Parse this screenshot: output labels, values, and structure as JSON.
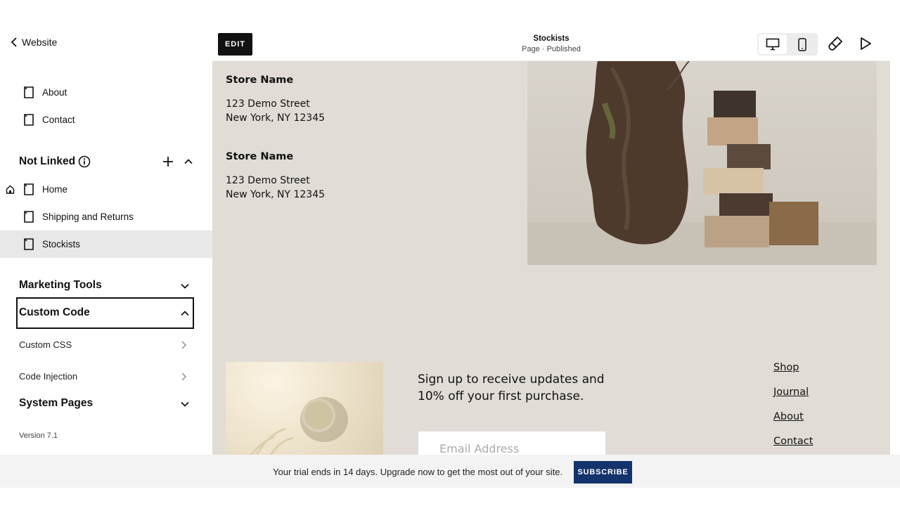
{
  "sidebar": {
    "back_label": "Website",
    "linked_items": [
      {
        "label": "About",
        "icon": "page-icon"
      },
      {
        "label": "Contact",
        "icon": "page-icon"
      }
    ],
    "not_linked": {
      "title": "Not Linked",
      "items": [
        {
          "label": "Home",
          "icon": "page-icon",
          "is_homepage": true
        },
        {
          "label": "Shipping and Returns",
          "icon": "page-icon"
        },
        {
          "label": "Stockists",
          "icon": "page-icon",
          "active": true
        }
      ]
    },
    "marketing_tools": "Marketing Tools",
    "custom_code": {
      "title": "Custom Code",
      "items": [
        "Custom CSS",
        "Code Injection"
      ]
    },
    "system_pages": "System Pages",
    "version": "Version 7.1"
  },
  "toolbar": {
    "edit_label": "EDIT",
    "page_title": "Stockists",
    "page_status": "Page · Published"
  },
  "preview": {
    "stores": [
      {
        "name": "Store Name",
        "street": "123 Demo Street",
        "city": "New York, NY 12345"
      },
      {
        "name": "Store Name",
        "street": "123 Demo Street",
        "city": "New York, NY 12345"
      }
    ],
    "signup_text": "Sign up to receive updates and 10% off your first purchase.",
    "email_placeholder": "Email Address",
    "footer_links": [
      "Shop",
      "Journal",
      "About",
      "Contact"
    ]
  },
  "banner": {
    "text": "Your trial ends in 14 days. Upgrade now to get the most out of your site.",
    "button_label": "SUBSCRIBE"
  },
  "colors": {
    "preview_bg": "#e1ddd6",
    "subscribe_bg": "#12336b",
    "active_row": "#e8e8e8"
  }
}
